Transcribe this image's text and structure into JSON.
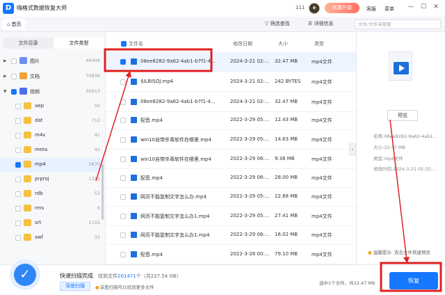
{
  "titlebar": {
    "logo_text": "D",
    "app_title": "嗨格式数据恢复大师",
    "user_id": "111",
    "vip_label": "优惠升级",
    "service_label": "客服",
    "menu_label": "菜单",
    "minimize": "—",
    "maximize": "☐",
    "close": "✕"
  },
  "tabbar": {
    "home_label": "首页",
    "filter_label": "筛选查找",
    "details_label": "详细信息",
    "search_placeholder": "文件/文件夹搜索"
  },
  "sidebar": {
    "tabs": [
      "文件目录",
      "文件类型"
    ],
    "items": [
      {
        "label": "图片",
        "count": "49406"
      },
      {
        "label": "文档",
        "count": "74939"
      },
      {
        "label": "视频",
        "count": "30913"
      },
      {
        "label": "aep",
        "count": "50"
      },
      {
        "label": "dat",
        "count": "712"
      },
      {
        "label": "m4v",
        "count": "41"
      },
      {
        "label": "meta",
        "count": "41"
      },
      {
        "label": "mp4",
        "count": "2670"
      },
      {
        "label": "prproj",
        "count": "1313"
      },
      {
        "label": "rdb",
        "count": "53"
      },
      {
        "label": "rms",
        "count": "6"
      },
      {
        "label": "srt",
        "count": "1155"
      },
      {
        "label": "swf",
        "count": "33"
      }
    ]
  },
  "list": {
    "headers": {
      "name": "文件名",
      "modified": "修改日期",
      "size": "大小",
      "type": "类型"
    },
    "rows": [
      {
        "name": "08ee8282-9a62-4ab1-b7f1-4...",
        "date": "2024-3-21 02:...",
        "size": "32.47 MB",
        "type": "mp4文件"
      },
      {
        "name": "$ILBISOJ.mp4",
        "date": "2024-3-21 02:...",
        "size": "242 BYTES",
        "type": "mp4文件"
      },
      {
        "name": "08ee8282-9a62-4ab1-b7f1-4...",
        "date": "2024-3-21 02:...",
        "size": "32.47 MB",
        "type": "mp4文件"
      },
      {
        "name": "配音.mp4",
        "date": "2022-3-29 05:...",
        "size": "12.43 MB",
        "type": "mp4文件"
      },
      {
        "name": "win10自带杀毒软件在哪里.mp4",
        "date": "2022-3-29 05:...",
        "size": "14.63 MB",
        "type": "mp4文件"
      },
      {
        "name": "win10自带杀毒软件在哪里.mp4",
        "date": "2022-3-29 06:...",
        "size": "9.38 MB",
        "type": "mp4文件"
      },
      {
        "name": "配音.mp4",
        "date": "2022-3-29 06:...",
        "size": "28.00 MB",
        "type": "mp4文件"
      },
      {
        "name": "网页不能复制文字怎么办.mp4",
        "date": "2022-3-29 05:...",
        "size": "22.88 MB",
        "type": "mp4文件"
      },
      {
        "name": "网页不能复制文字怎么办1.mp4",
        "date": "2022-3-29 05:...",
        "size": "27.41 MB",
        "type": "mp4文件"
      },
      {
        "name": "网页不能复制文字怎么办1.mp4",
        "date": "2022-3-29 06:...",
        "size": "16.02 MB",
        "type": "mp4文件"
      },
      {
        "name": "配音.mp4",
        "date": "2022-3-28 00:...",
        "size": "79.10 MB",
        "type": "mp4文件"
      }
    ]
  },
  "details": {
    "preview_label": "预览",
    "name_label": "名称:",
    "name_value": "08ee8282-9a62-4ab1...",
    "size_label": "大小:",
    "size_value": "32.47 MB",
    "type_label": "类型:",
    "type_value": "mp4文件",
    "modified_label": "修改时间:",
    "modified_value": "2024-3-21 02:32:...",
    "tip": "温馨提示: 双击文件快速预览"
  },
  "bottom": {
    "scan_done": "快速扫描完成",
    "found_prefix": "找到文件",
    "found_count": "201471",
    "found_suffix": "个（共227.54 GB）",
    "deep_scan": "深度扫描",
    "deep_tip": "深度扫描可以找到更多文件",
    "selected_info": "选中1个文件，共32.47 MB",
    "recover_label": "恢复"
  },
  "colors": {
    "accent": "#1677ff",
    "annotation": "#e02020"
  }
}
